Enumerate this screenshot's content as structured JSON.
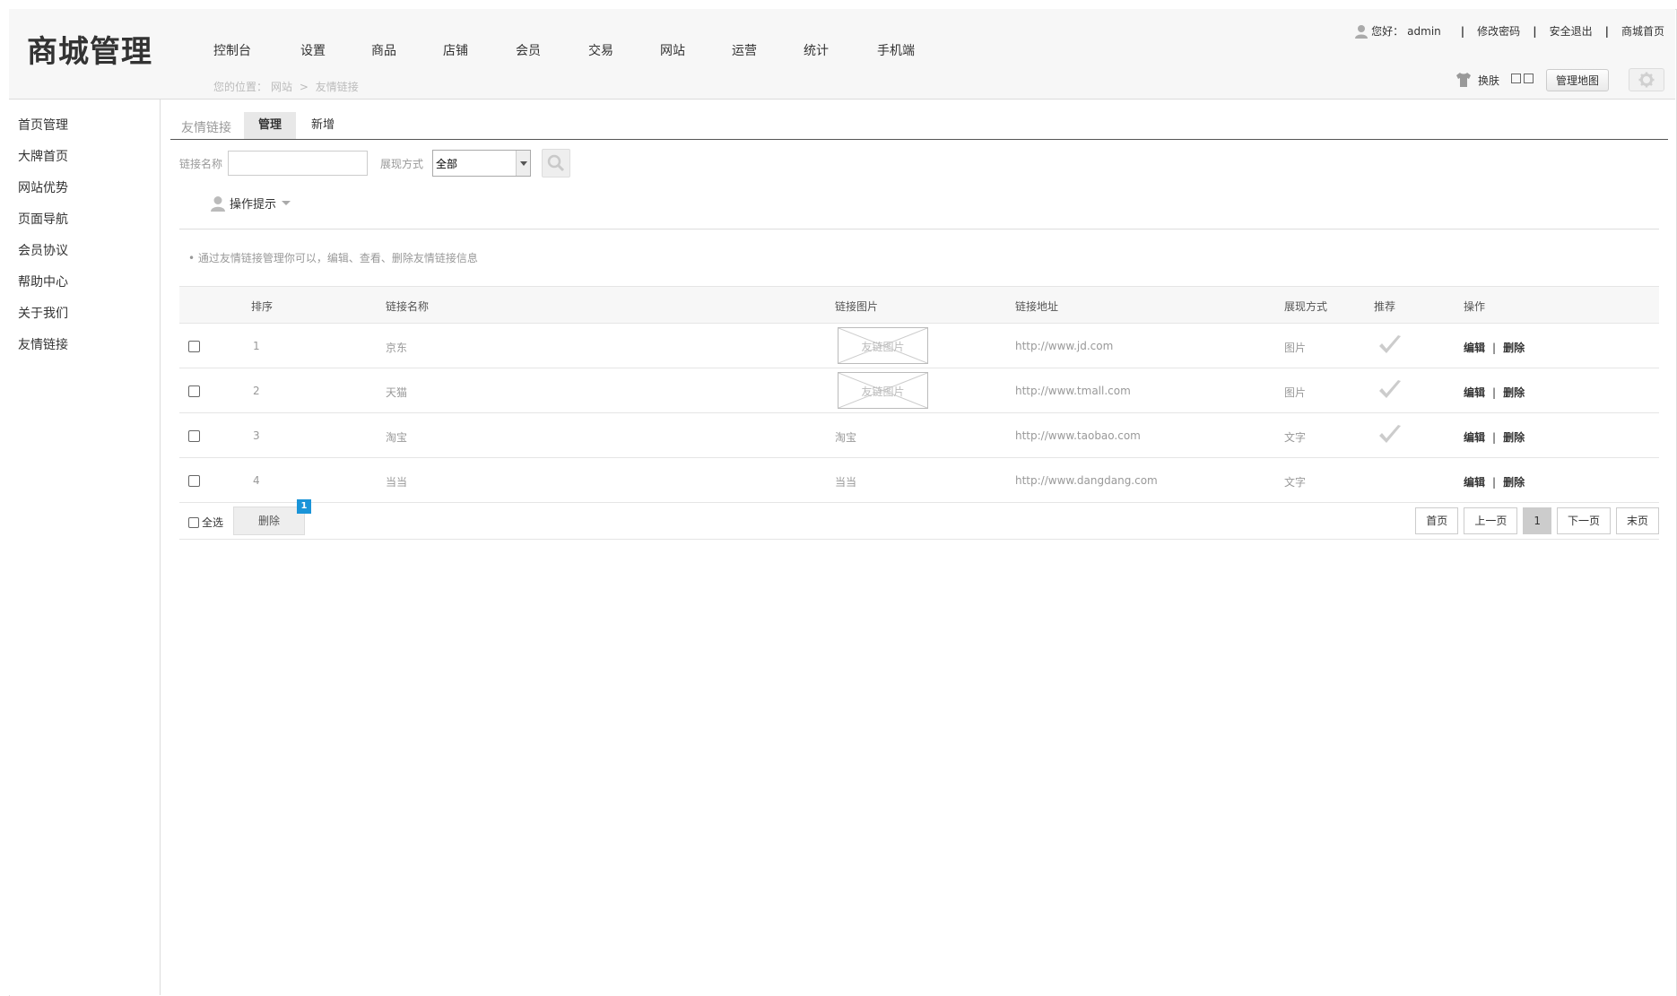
{
  "header": {
    "logo": "商城管理",
    "nav": [
      "控制台",
      "设置",
      "商品",
      "店铺",
      "会员",
      "交易",
      "网站",
      "运营",
      "统计",
      "手机端"
    ],
    "breadcrumb": {
      "prefix": "您的位置：",
      "level1": "网站",
      "sep": ">",
      "level2": "友情链接"
    },
    "greeting": "您好：",
    "username": "admin",
    "links": [
      "修改密码",
      "安全退出",
      "商城首页"
    ],
    "skin_label": "换肤",
    "map_button": "管理地图"
  },
  "sidebar": {
    "items": [
      "首页管理",
      "大牌首页",
      "网站优势",
      "页面导航",
      "会员协议",
      "帮助中心",
      "关于我们",
      "友情链接"
    ]
  },
  "tabs": {
    "title": "友情链接",
    "items": [
      "管理",
      "新增"
    ],
    "active": "管理"
  },
  "search": {
    "name_label": "链接名称",
    "name_value": "",
    "mode_label": "展现方式",
    "mode_value": "全部"
  },
  "tips": {
    "toggle_label": "操作提示",
    "text": "• 通过友情链接管理你可以，编辑、查看、删除友情链接信息"
  },
  "table": {
    "headers": [
      "排序",
      "链接名称",
      "链接图片",
      "链接地址",
      "展现方式",
      "推荐",
      "操作"
    ],
    "rows": [
      {
        "order": "1",
        "name": "京东",
        "image": "友链图片",
        "image_is_picture": true,
        "url": "http://www.jd.com",
        "mode": "图片",
        "recommended": true
      },
      {
        "order": "2",
        "name": "天猫",
        "image": "友链图片",
        "image_is_picture": true,
        "url": "http://www.tmall.com",
        "mode": "图片",
        "recommended": true
      },
      {
        "order": "3",
        "name": "淘宝",
        "image": "淘宝",
        "image_is_picture": false,
        "url": "http://www.taobao.com",
        "mode": "文字",
        "recommended": true
      },
      {
        "order": "4",
        "name": "当当",
        "image": "当当",
        "image_is_picture": false,
        "url": "http://www.dangdang.com",
        "mode": "文字",
        "recommended": false
      }
    ],
    "op_edit": "编辑",
    "op_sep": "|",
    "op_delete": "删除"
  },
  "footer": {
    "select_all": "全选",
    "delete_button": "删除",
    "badge_count": "1",
    "pager": [
      "首页",
      "上一页",
      "1",
      "下一页",
      "末页"
    ],
    "current_page": "1"
  },
  "colors": {
    "badge": "#1a94d8",
    "active_tab": "#e8e8e8",
    "header_bg": "#f7f7f7"
  }
}
